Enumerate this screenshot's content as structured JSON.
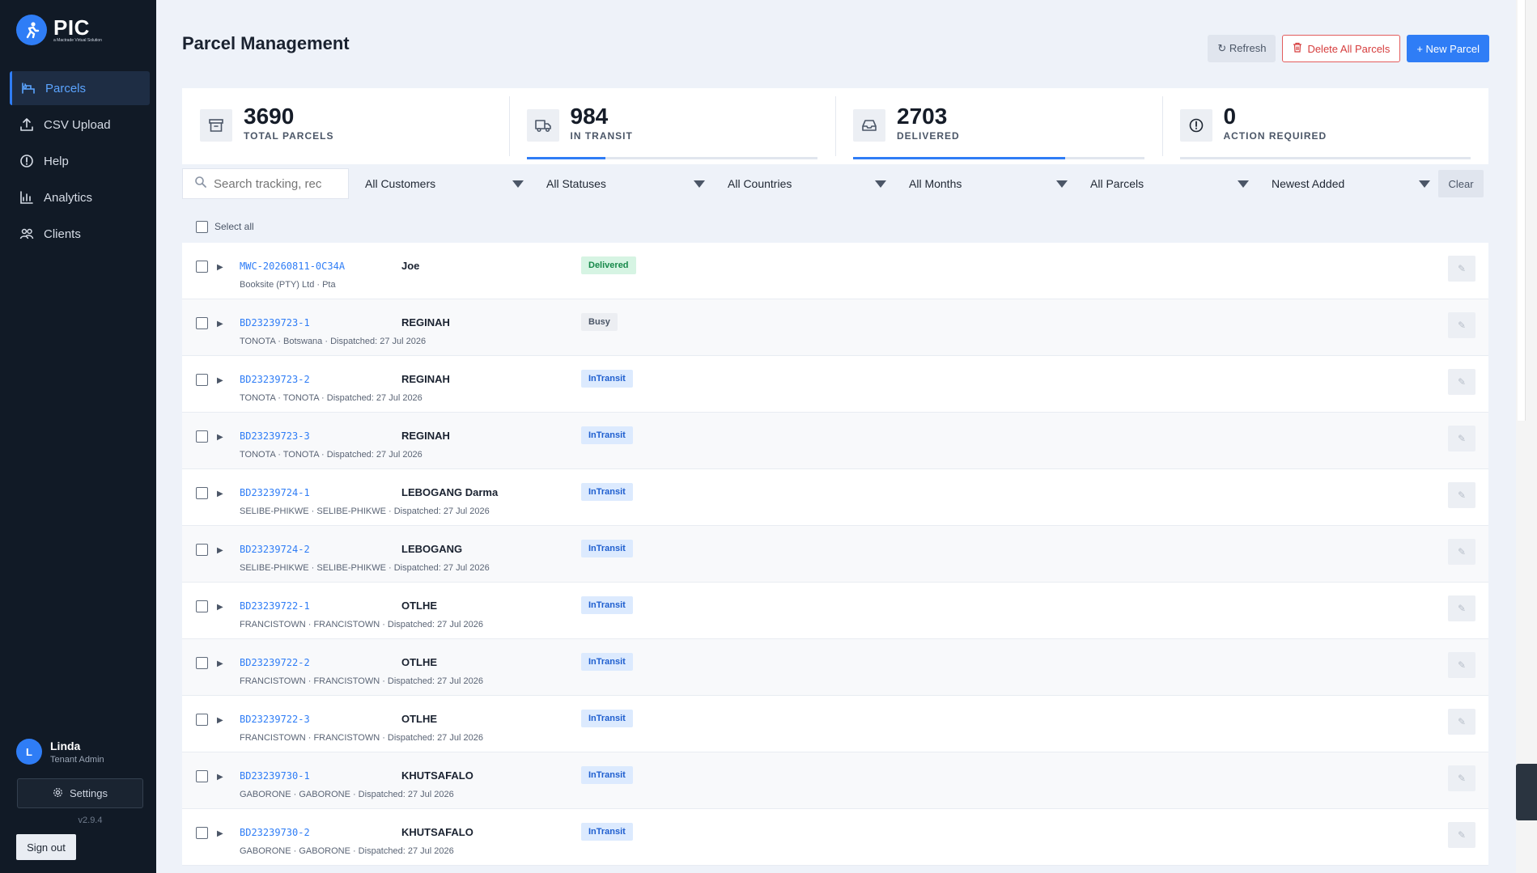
{
  "app": {
    "brand": "PIC",
    "tagline": "a Mactrade Virtual Solution"
  },
  "sidebar": {
    "items": [
      {
        "label": "Parcels",
        "icon": "parcel-icon"
      },
      {
        "label": "CSV Upload",
        "icon": "upload-icon"
      },
      {
        "label": "Help",
        "icon": "info-icon"
      },
      {
        "label": "Analytics",
        "icon": "chart-icon"
      },
      {
        "label": "Clients",
        "icon": "users-icon"
      }
    ],
    "user": {
      "initial": "L",
      "name": "Linda",
      "role": "Tenant Admin"
    },
    "settings_label": "Settings",
    "version": "v2.9.4",
    "signout_label": "Sign out"
  },
  "header": {
    "title": "Parcel Management",
    "refresh_label": "↻ Refresh",
    "delete_label": "Delete All Parcels",
    "new_label": "+ New Parcel"
  },
  "stats": [
    {
      "value": "3690",
      "label": "TOTAL PARCELS",
      "progress": null
    },
    {
      "value": "984",
      "label": "IN TRANSIT",
      "progress": 0.27
    },
    {
      "value": "2703",
      "label": "DELIVERED",
      "progress": 0.73
    },
    {
      "value": "0",
      "label": "ACTION REQUIRED",
      "progress": 0
    }
  ],
  "filters": {
    "search_placeholder": "Search tracking, rec",
    "customers": "All Customers",
    "statuses": "All Statuses",
    "countries": "All Countries",
    "months": "All Months",
    "parcels": "All Parcels",
    "sort": "Newest Added",
    "clear_label": "Clear"
  },
  "table": {
    "select_all_label": "Select all",
    "rows": [
      {
        "tracking": "MWC-20260811-0C34A",
        "client": "Joe",
        "sub": "Booksite (PTY) Ltd · Pta",
        "status": "Delivered",
        "status_class": "delivered"
      },
      {
        "tracking": "BD23239723-1",
        "client": "REGINAH",
        "sub": "TONOTA · Botswana · Dispatched: 27 Jul 2026",
        "status": "Busy",
        "status_class": "busy"
      },
      {
        "tracking": "BD23239723-2",
        "client": "REGINAH",
        "sub": "TONOTA · TONOTA · Dispatched: 27 Jul 2026",
        "status": "InTransit",
        "status_class": "intransit"
      },
      {
        "tracking": "BD23239723-3",
        "client": "REGINAH",
        "sub": "TONOTA · TONOTA · Dispatched: 27 Jul 2026",
        "status": "InTransit",
        "status_class": "intransit"
      },
      {
        "tracking": "BD23239724-1",
        "client": "LEBOGANG Darma",
        "sub": "SELIBE-PHIKWE · SELIBE-PHIKWE · Dispatched: 27 Jul 2026",
        "status": "InTransit",
        "status_class": "intransit"
      },
      {
        "tracking": "BD23239724-2",
        "client": "LEBOGANG",
        "sub": "SELIBE-PHIKWE · SELIBE-PHIKWE · Dispatched: 27 Jul 2026",
        "status": "InTransit",
        "status_class": "intransit"
      },
      {
        "tracking": "BD23239722-1",
        "client": "OTLHE",
        "sub": "FRANCISTOWN · FRANCISTOWN · Dispatched: 27 Jul 2026",
        "status": "InTransit",
        "status_class": "intransit"
      },
      {
        "tracking": "BD23239722-2",
        "client": "OTLHE",
        "sub": "FRANCISTOWN · FRANCISTOWN · Dispatched: 27 Jul 2026",
        "status": "InTransit",
        "status_class": "intransit"
      },
      {
        "tracking": "BD23239722-3",
        "client": "OTLHE",
        "sub": "FRANCISTOWN · FRANCISTOWN · Dispatched: 27 Jul 2026",
        "status": "InTransit",
        "status_class": "intransit"
      },
      {
        "tracking": "BD23239730-1",
        "client": "KHUTSAFALO",
        "sub": "GABORONE · GABORONE · Dispatched: 27 Jul 2026",
        "status": "InTransit",
        "status_class": "intransit"
      },
      {
        "tracking": "BD23239730-2",
        "client": "KHUTSAFALO",
        "sub": "GABORONE · GABORONE · Dispatched: 27 Jul 2026",
        "status": "InTransit",
        "status_class": "intransit"
      }
    ]
  },
  "colors": {
    "accent": "#2f7df6",
    "sidebar": "#111a26",
    "danger": "#d63d3d",
    "success": "#17894a"
  }
}
